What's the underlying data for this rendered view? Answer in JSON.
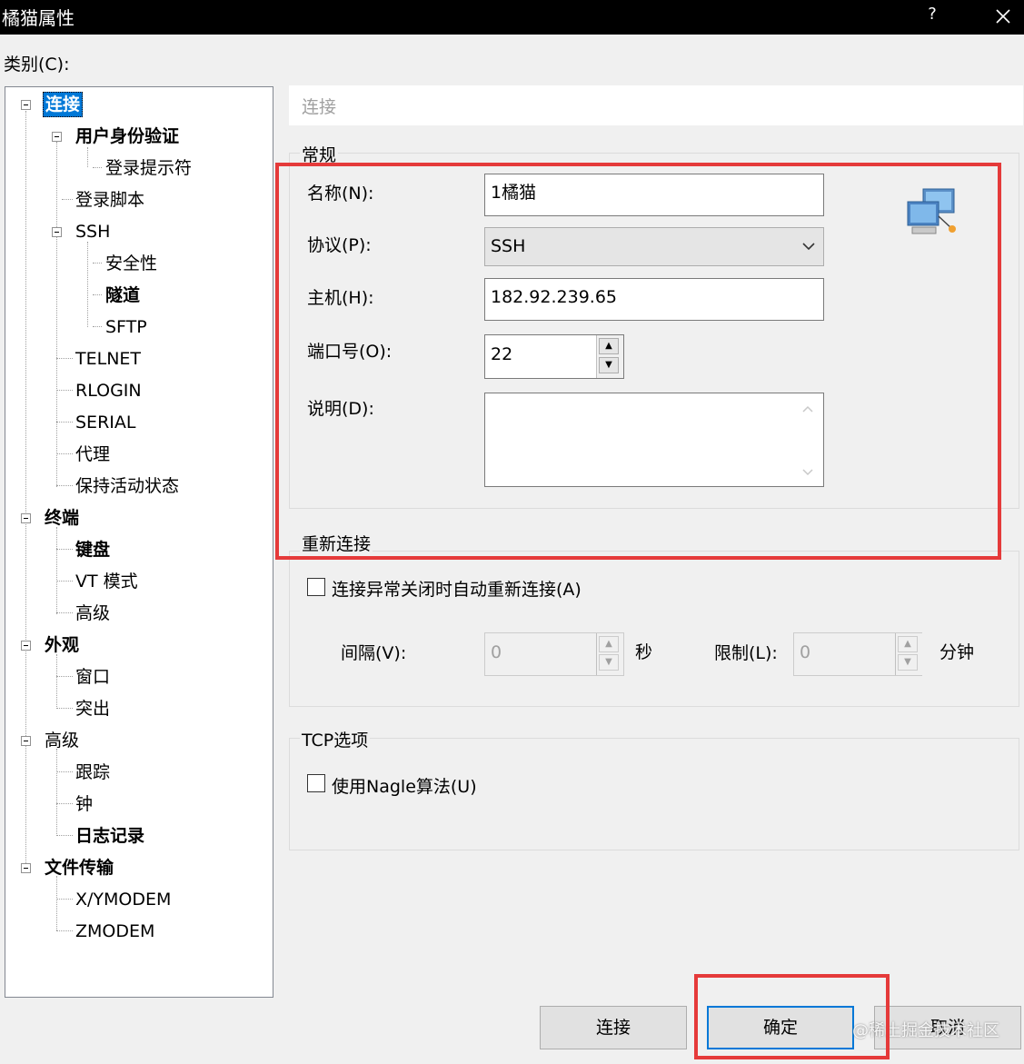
{
  "window": {
    "title": "橘猫属性",
    "help_label": "?"
  },
  "category_label": "类别(C):",
  "tree": {
    "items": [
      {
        "label": "连接"
      },
      {
        "label": "用户身份验证"
      },
      {
        "label": "登录提示符"
      },
      {
        "label": "登录脚本"
      },
      {
        "label": "SSH"
      },
      {
        "label": "安全性"
      },
      {
        "label": "隧道"
      },
      {
        "label": "SFTP"
      },
      {
        "label": "TELNET"
      },
      {
        "label": "RLOGIN"
      },
      {
        "label": "SERIAL"
      },
      {
        "label": "代理"
      },
      {
        "label": "保持活动状态"
      },
      {
        "label": "终端"
      },
      {
        "label": "键盘"
      },
      {
        "label": "VT 模式"
      },
      {
        "label": "高级"
      },
      {
        "label": "外观"
      },
      {
        "label": "窗口"
      },
      {
        "label": "突出"
      },
      {
        "label": "高级"
      },
      {
        "label": "跟踪"
      },
      {
        "label": "钟"
      },
      {
        "label": "日志记录"
      },
      {
        "label": "文件传输"
      },
      {
        "label": "X/YMODEM"
      },
      {
        "label": "ZMODEM"
      }
    ]
  },
  "panel": {
    "title": "连接",
    "general": {
      "title": "常规",
      "name_label": "名称(N):",
      "name_value": "1橘猫",
      "protocol_label": "协议(P):",
      "protocol_value": "SSH",
      "host_label": "主机(H):",
      "host_value": "182.92.239.65",
      "port_label": "端口号(O):",
      "port_value": "22",
      "desc_label": "说明(D):",
      "desc_value": ""
    },
    "reconnect": {
      "title": "重新连接",
      "auto_label": "连接异常关闭时自动重新连接(A)",
      "interval_label": "间隔(V):",
      "interval_value": "0",
      "interval_unit": "秒",
      "limit_label": "限制(L):",
      "limit_value": "0",
      "limit_unit": "分钟"
    },
    "tcp": {
      "title": "TCP选项",
      "nagle_label": "使用Nagle算法(U)"
    }
  },
  "buttons": {
    "connect": "连接",
    "ok": "确定",
    "cancel": "取消"
  },
  "watermark": "@稀土掘金技术社区",
  "colors": {
    "highlight": "#e53a3a",
    "selection": "#0078d7"
  }
}
